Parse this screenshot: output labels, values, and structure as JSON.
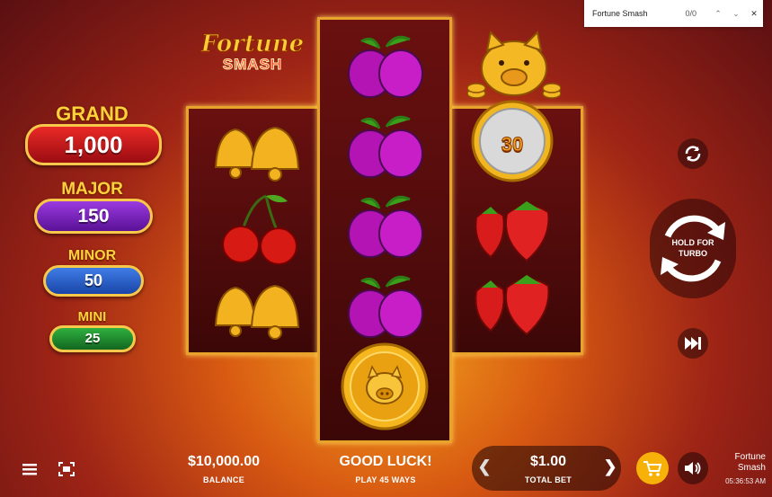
{
  "find_bar": {
    "query": "Fortune Smash",
    "count": "0/0",
    "up": "⌃",
    "down": "⌄",
    "close": "✕"
  },
  "logo": {
    "line1": "Fortune",
    "line2": "SMASH"
  },
  "jackpots": [
    {
      "name": "GRAND",
      "value": "1,000",
      "color": "#c8161c"
    },
    {
      "name": "MAJOR",
      "value": "150",
      "color": "#7a1fc4"
    },
    {
      "name": "MINOR",
      "value": "50",
      "color": "#2057c9"
    },
    {
      "name": "MINI",
      "value": "25",
      "color": "#1c8a2c"
    }
  ],
  "reels": {
    "reel1": [
      "bell",
      "cherry",
      "bell"
    ],
    "reel2": [
      "plum",
      "plum",
      "plum",
      "plum",
      "pig-coin"
    ],
    "reel3": [
      "silver-coin",
      "strawberry",
      "strawberry"
    ],
    "coin_value": "30"
  },
  "controls": {
    "hold_label": "HOLD FOR TURBO"
  },
  "bottom": {
    "balance_value": "$10,000.00",
    "balance_label": "BALANCE",
    "message": "GOOD LUCK!",
    "message_sub": "PLAY 45 WAYS",
    "bet_value": "$1.00",
    "bet_label": "TOTAL BET",
    "left_arrow": "❮",
    "right_arrow": "❯",
    "game_name": "Fortune Smash",
    "time": "05:36:53 AM"
  },
  "colors": {
    "gold": "#f5b82e",
    "reel_border": "#e8a42a",
    "buy_button": "#f7b20a"
  }
}
